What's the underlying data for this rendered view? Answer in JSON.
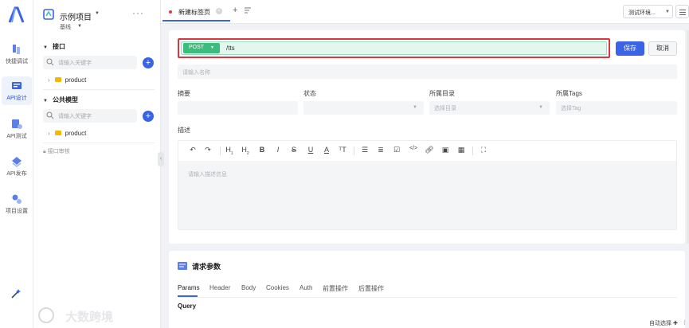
{
  "rail": {
    "items": [
      {
        "label": "快捷调试",
        "icon": "quick-debug-icon"
      },
      {
        "label": "API设计",
        "icon": "api-design-icon",
        "active": true
      },
      {
        "label": "API测试",
        "icon": "api-test-icon"
      },
      {
        "label": "API发布",
        "icon": "api-publish-icon"
      },
      {
        "label": "项目设置",
        "icon": "project-settings-icon"
      }
    ]
  },
  "sidebar": {
    "project_name": "示例项目",
    "branch": "基线",
    "more": "···",
    "sections": [
      {
        "title": "接口",
        "search_placeholder": "请输入关键字",
        "folder": "product"
      },
      {
        "title": "公共模型",
        "search_placeholder": "请输入关键字",
        "folder": "product"
      }
    ],
    "recycle": "接口审核"
  },
  "watermark": "大数跨境",
  "tabbar": {
    "tab_label": "新建标签页",
    "add": "+",
    "environment": "测试环境..."
  },
  "request": {
    "method": "POST",
    "path": "/tts",
    "save_label": "保存",
    "cancel_label": "取消",
    "name_placeholder": "请输入名称"
  },
  "fields": {
    "summary_label": "摘要",
    "status_label": "状态",
    "directory_label": "所属目录",
    "directory_placeholder": "选择目录",
    "tags_label": "所属Tags",
    "tags_placeholder": "选择Tag",
    "description_label": "描述",
    "description_placeholder": "请输入描述信息"
  },
  "params": {
    "title": "请求参数",
    "tabs": [
      "Params",
      "Header",
      "Body",
      "Cookies",
      "Auth",
      "前置操作",
      "后置操作"
    ],
    "active_tab": "Params",
    "query_label": "Query"
  },
  "footer": {
    "auto_select": "自动选择 ✚",
    "extra": "⟨"
  },
  "colors": {
    "primary": "#3b63e6",
    "method_post": "#3dbd7d",
    "url_bg": "#e3f7ee",
    "highlight_border": "#d9363e",
    "folder": "#f5b800"
  }
}
